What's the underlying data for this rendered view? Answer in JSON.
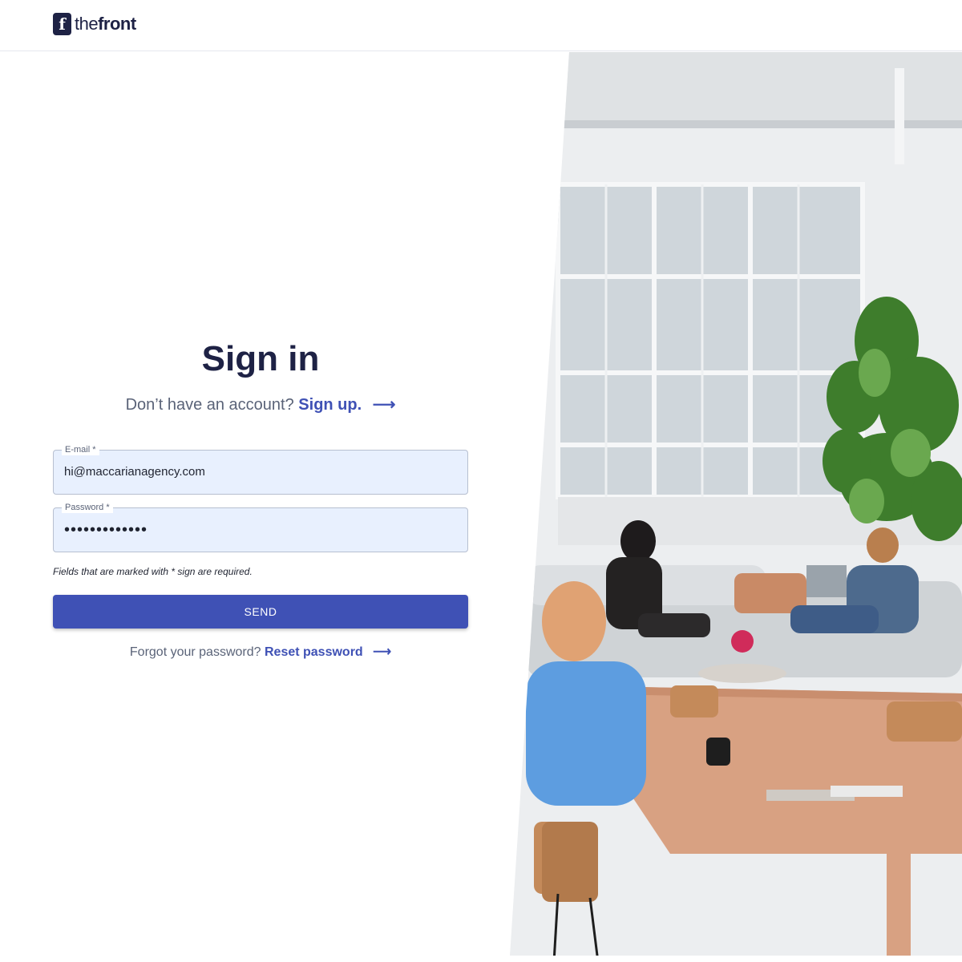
{
  "brand": {
    "mark": "f",
    "name_light": "the",
    "name_bold": "front"
  },
  "signin": {
    "title": "Sign in",
    "prompt": "Don’t have an account?",
    "signup_label": "Sign up.",
    "arrow": "⟶"
  },
  "form": {
    "email": {
      "label": "E-mail *",
      "value": "hi@maccarianagency.com"
    },
    "password": {
      "label": "Password *",
      "value": "•••••••••••••"
    },
    "required_note": "Fields that are marked with * sign are required.",
    "submit_label": "SEND"
  },
  "forgot": {
    "prompt": "Forgot your password?",
    "link_label": "Reset password",
    "arrow": "⟶"
  },
  "colors": {
    "primary": "#3f51b5",
    "dark": "#1e2245",
    "input_bg": "#e8f0fe"
  },
  "icons": {
    "arrow": "arrow-right-icon",
    "logo": "thefront-logo-icon"
  }
}
